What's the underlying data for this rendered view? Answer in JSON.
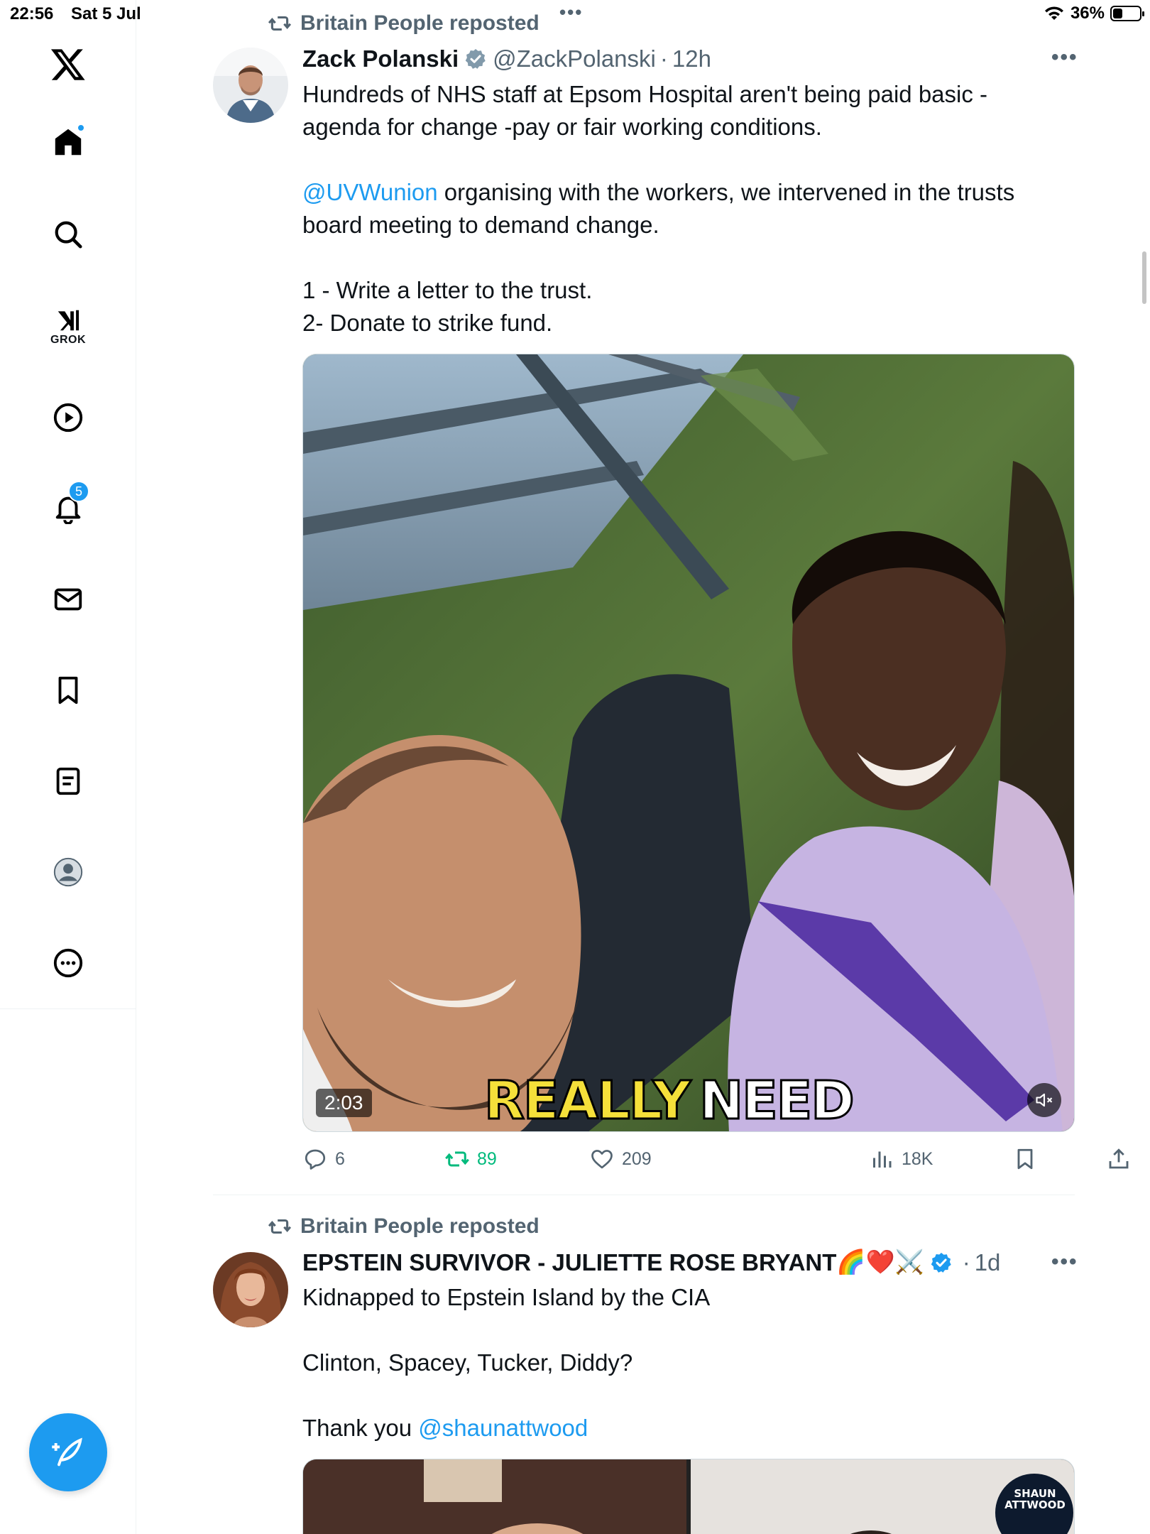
{
  "status_bar": {
    "time": "22:56",
    "date": "Sat 5 Jul",
    "battery_percent": "36%",
    "battery_level": 0.36
  },
  "sidebar": {
    "items": [
      {
        "name": "x-logo-icon"
      },
      {
        "name": "home-icon",
        "has_dot": true
      },
      {
        "name": "search-icon"
      },
      {
        "name": "grok-icon",
        "label": "GROK"
      },
      {
        "name": "video-icon"
      },
      {
        "name": "notifications-icon",
        "badge": "5"
      },
      {
        "name": "messages-icon"
      },
      {
        "name": "bookmarks-icon"
      },
      {
        "name": "lists-icon"
      },
      {
        "name": "profile-icon"
      },
      {
        "name": "more-icon"
      }
    ]
  },
  "colors": {
    "accent": "#1d9bf0",
    "retweet_green": "#00ba7c",
    "secondary_text": "#536471"
  },
  "tweets": [
    {
      "repost_label": "Britain People reposted",
      "author_name": "Zack Polanski",
      "handle": "@ZackPolanski",
      "time": "12h",
      "verified_color": "#829aab",
      "text_lines": [
        {
          "text": "Hundreds of NHS staff at Epsom Hospital aren't being paid basic -"
        },
        {
          "text": "agenda for change -pay or fair working conditions."
        },
        {
          "text": ""
        },
        {
          "mention": "@UVWunion",
          "text": " organising with the workers, we intervened in the trusts"
        },
        {
          "text": "board meeting to demand change."
        },
        {
          "text": ""
        },
        {
          "text": "1 - Write a letter to the trust."
        },
        {
          "text": "2- Donate to strike fund."
        }
      ],
      "video": {
        "duration": "2:03",
        "caption_word_1": "REALLY",
        "caption_word_2": "NEED"
      },
      "stats": {
        "replies": "6",
        "reposts": "89",
        "likes": "209",
        "views": "18K"
      }
    },
    {
      "repost_label": "Britain People reposted",
      "author_name": "EPSTEIN SURVIVOR - JULIETTE ROSE BRYANT",
      "author_emoji": "🌈❤️⚔️",
      "time": "1d",
      "verified_color": "#1d9bf0",
      "text_lines": [
        {
          "text": "Kidnapped to Epstein Island by the CIA"
        },
        {
          "text": ""
        },
        {
          "text": "Clinton, Spacey, Tucker, Diddy?"
        },
        {
          "text": ""
        },
        {
          "text": "Thank you ",
          "mention": "@shaunattwood"
        }
      ],
      "media_logo": {
        "line1": "SHAUN",
        "line2": "ATTWOOD"
      }
    }
  ]
}
